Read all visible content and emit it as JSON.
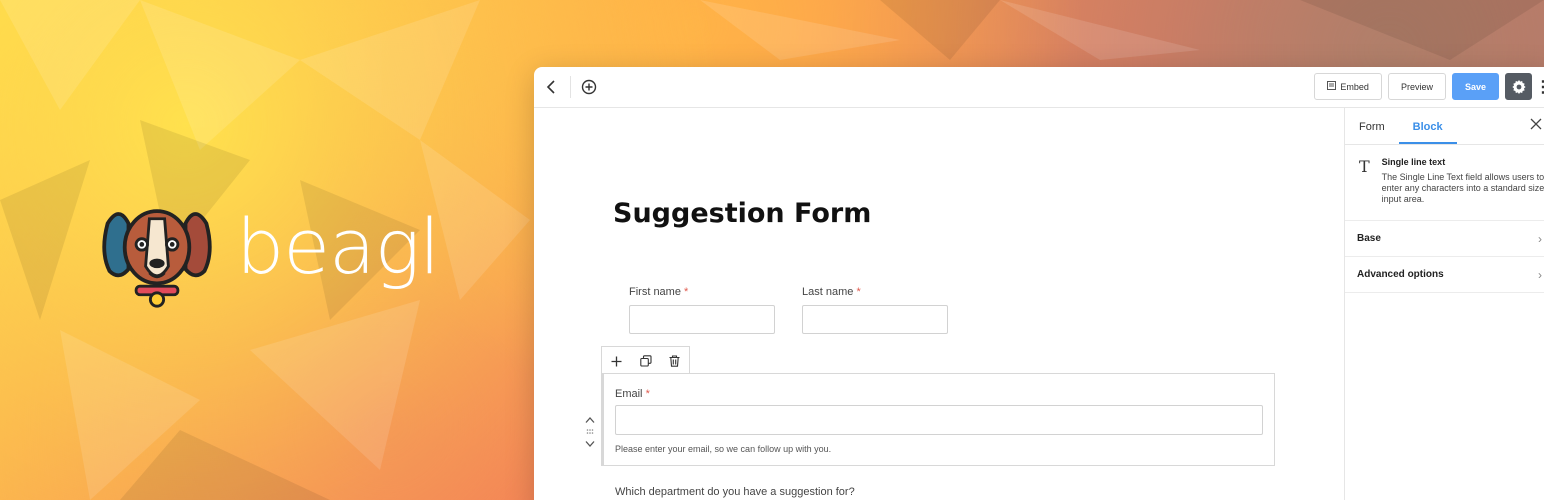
{
  "brand": {
    "name": "beagl",
    "logo_icon": "beagle-dog-icon"
  },
  "toolbar": {
    "back_icon": "chevron-left-icon",
    "add_icon": "plus-circle-icon",
    "embed_label": "Embed",
    "preview_label": "Preview",
    "save_label": "Save",
    "settings_icon": "gear-icon",
    "more_icon": "more-vertical-icon"
  },
  "form": {
    "title": "Suggestion Form",
    "first_name_label": "First name",
    "last_name_label": "Last name",
    "required_mark": "*",
    "email_label": "Email",
    "email_help": "Please enter your email, so we can follow up with you.",
    "department_label": "Which department do you have a suggestion for?"
  },
  "block_toolbar": {
    "add_icon": "plus-icon",
    "duplicate_icon": "copy-icon",
    "delete_icon": "trash-icon"
  },
  "panel": {
    "tabs": [
      {
        "label": "Form"
      },
      {
        "label": "Block"
      }
    ],
    "block_title": "Single line text",
    "block_description": "The Single Line Text field allows users to enter any characters into a standard sized input area.",
    "sections": [
      {
        "label": "Base"
      },
      {
        "label": "Advanced options"
      }
    ]
  },
  "colors": {
    "accent": "#3b8fe8",
    "save_button": "#5aa0f7",
    "required": "#e05a4e"
  }
}
